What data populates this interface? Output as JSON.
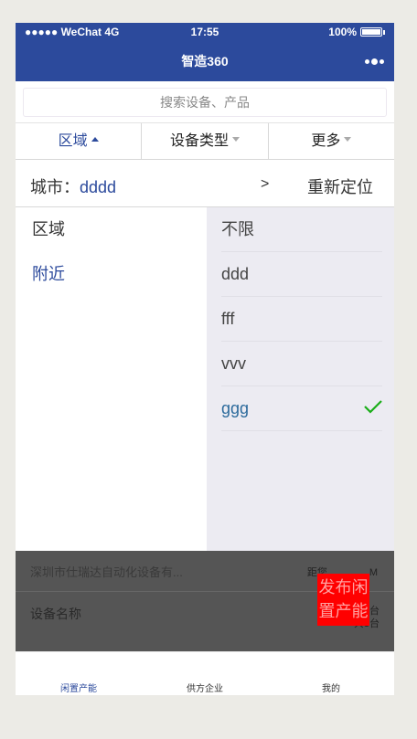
{
  "status_bar": {
    "carrier": "●●●●● WeChat 4G",
    "time": "17:55",
    "battery": "100%"
  },
  "navbar": {
    "title": "智造360"
  },
  "search": {
    "placeholder": "搜索设备、产品"
  },
  "filters": [
    {
      "label": "区域",
      "active": true
    },
    {
      "label": "设备类型",
      "active": false
    },
    {
      "label": "更多",
      "active": false
    }
  ],
  "city": {
    "label": "城市：",
    "value": "dddd",
    "arrow": ">",
    "relocate": "重新定位"
  },
  "left_list": [
    {
      "label": "区域",
      "active": false
    },
    {
      "label": "附近",
      "active": true
    }
  ],
  "right_list": [
    {
      "label": "不限",
      "selected": false
    },
    {
      "label": "ddd",
      "selected": false
    },
    {
      "label": "fff",
      "selected": false
    },
    {
      "label": "vvv",
      "selected": false
    },
    {
      "label": "ggg",
      "selected": true
    }
  ],
  "background_content": {
    "company": "深圳市仕瑞达自动化设备有...",
    "distance": "距您",
    "distance_suffix": "M",
    "device_name": "设备名称",
    "idle": "闲2台",
    "total": "共3台"
  },
  "publish_button": {
    "label": "发布闲置产能"
  },
  "tabbar": [
    {
      "label": "闲置产能",
      "active": true
    },
    {
      "label": "供方企业",
      "active": false
    },
    {
      "label": "我的",
      "active": false
    }
  ],
  "colors": {
    "primary": "#2c4a9c",
    "check": "#1aad19",
    "publish": "#ff0000"
  }
}
